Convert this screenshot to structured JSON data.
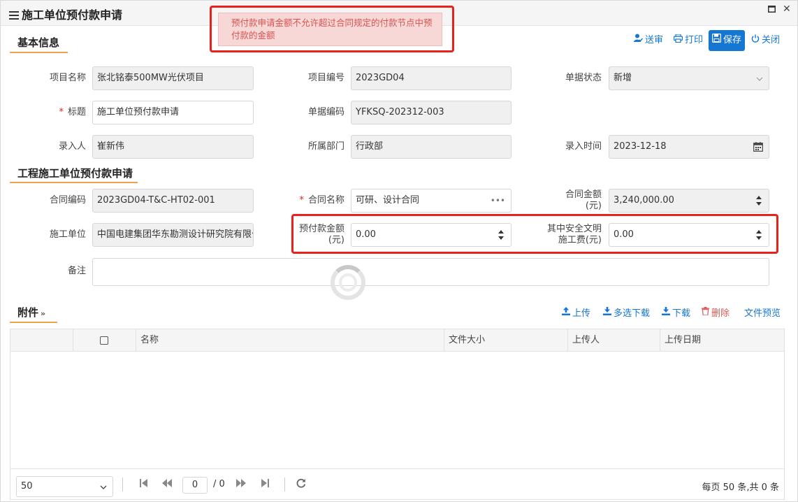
{
  "window": {
    "title": "施工单位预付款申请",
    "menu_icon": "hamburger-icon",
    "maximize_icon": "maximize-icon",
    "close_icon": "close-icon"
  },
  "toast": {
    "message": "预付款申请金额不允许超过合同规定的付款节点中预付款的金额"
  },
  "toolbar": {
    "submit_label": "送审",
    "print_label": "打印",
    "save_label": "保存",
    "close_label": "关闭"
  },
  "sections": {
    "basic": "基本信息",
    "construction": "工程施工单位预付款申请",
    "attachments": "附件"
  },
  "basic": {
    "project_name_label": "项目名称",
    "project_name": "张北铭泰500MW光伏项目",
    "project_no_label": "项目编号",
    "project_no": "2023GD04",
    "status_label": "单据状态",
    "status": "新增",
    "title_label": "标题",
    "title": "施工单位预付款申请",
    "doc_no_label": "单据编码",
    "doc_no": "YFKSQ-202312-003",
    "entered_by_label": "录入人",
    "entered_by": "崔新伟",
    "dept_label": "所属部门",
    "dept": "行政部",
    "entry_time_label": "录入时间",
    "entry_time": "2023-12-18"
  },
  "construction": {
    "contract_no_label": "合同编码",
    "contract_no": "2023GD04-T&C-HT02-001",
    "contract_name_label": "合同名称",
    "contract_name": "可研、设计合同",
    "contract_name_suffix": "•••",
    "contract_amount_label_1": "合同金额",
    "contract_amount_label_2": "(元)",
    "contract_amount": "3,240,000.00",
    "unit_label": "施工单位",
    "unit": "中国电建集团华东勘测设计研究院有限公司",
    "prepay_label_1": "预付款金额",
    "prepay_label_2": "(元)",
    "prepay": "0.00",
    "safety_label_1": "其中安全文明",
    "safety_label_2": "施工费(元)",
    "safety": "0.00",
    "remark_label": "备注",
    "remark": ""
  },
  "attachments": {
    "upload_label": "上传",
    "multi_download_label": "多选下载",
    "download_label": "下载",
    "delete_label": "删除",
    "preview_label": "文件预览",
    "columns": [
      "名称",
      "文件大小",
      "上传人",
      "上传日期"
    ]
  },
  "pager": {
    "page_size": "50",
    "page_input": "0",
    "page_total": "/ 0",
    "summary": "每页 50 条,共 0 条"
  }
}
